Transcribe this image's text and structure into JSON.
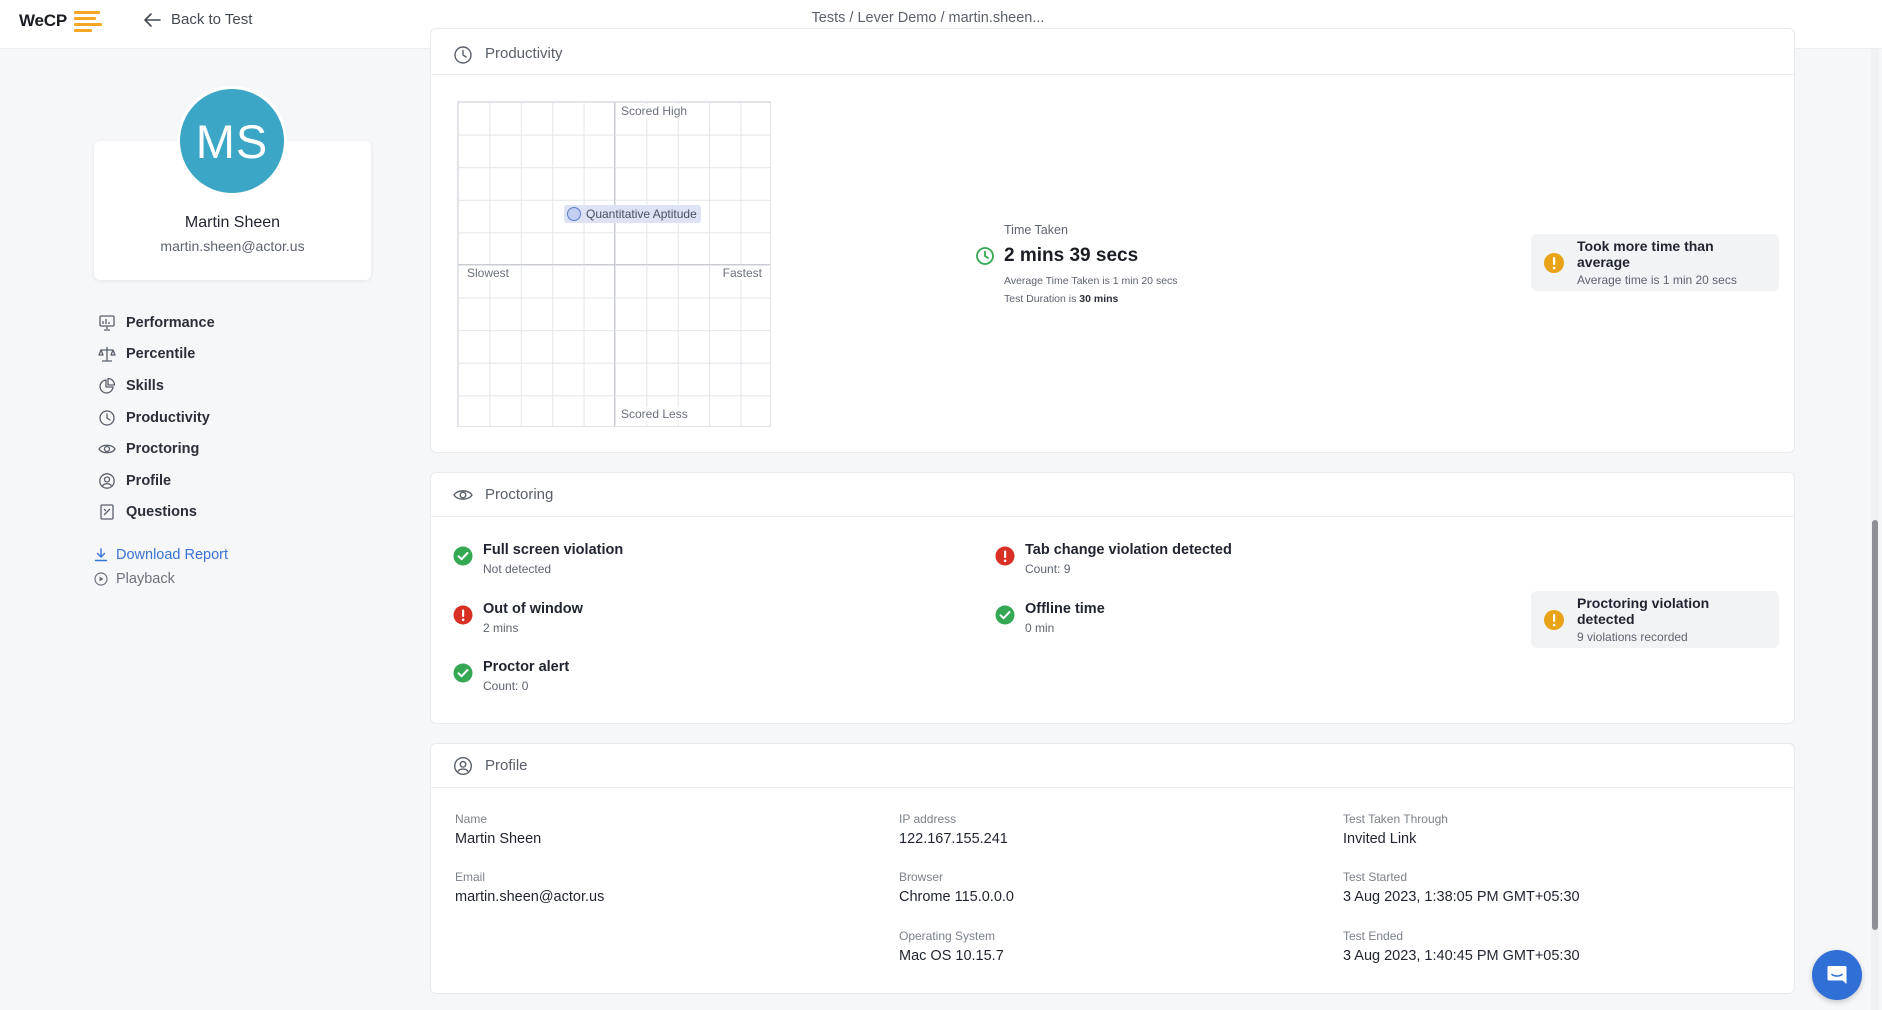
{
  "topbar": {
    "logo_text": "WeCP",
    "back_label": "Back to Test",
    "breadcrumb": "Tests / Lever Demo / martin.sheen..."
  },
  "candidate": {
    "initials": "MS",
    "name": "Martin Sheen",
    "email": "martin.sheen@actor.us",
    "avatar_color": "#3ba6c6"
  },
  "nav": {
    "items": [
      {
        "label": "Performance",
        "icon": "performance-icon"
      },
      {
        "label": "Percentile",
        "icon": "scale-icon"
      },
      {
        "label": "Skills",
        "icon": "pie-chart-icon"
      },
      {
        "label": "Productivity",
        "icon": "clock-icon"
      },
      {
        "label": "Proctoring",
        "icon": "eye-icon"
      },
      {
        "label": "Profile",
        "icon": "user-circle-icon"
      },
      {
        "label": "Questions",
        "icon": "questions-icon"
      }
    ],
    "download_label": "Download Report",
    "playback_label": "Playback"
  },
  "productivity": {
    "title": "Productivity",
    "chart_data": {
      "type": "scatter",
      "quadrant_labels": {
        "top": "Scored High",
        "bottom": "Scored Less",
        "left": "Slowest",
        "right": "Fastest"
      },
      "points": [
        {
          "label": "Quantitative Aptitude",
          "quadrant": "top-left"
        }
      ]
    },
    "time_taken_label": "Time Taken",
    "time_taken_value": "2 mins 39 secs",
    "avg_time_text": "Average Time Taken is 1 min 20 secs",
    "duration_prefix": "Test Duration is",
    "duration_value": "30 mins",
    "alert": {
      "title": "Took more time than average",
      "subtitle": "Average time is 1 min 20 secs"
    }
  },
  "proctoring": {
    "title": "Proctoring",
    "items": [
      {
        "title": "Full screen violation",
        "subtitle": "Not detected",
        "status": "ok"
      },
      {
        "title": "Tab change violation detected",
        "subtitle": "Count: 9",
        "status": "error"
      },
      {
        "title": "Out of window",
        "subtitle": "2 mins",
        "status": "error"
      },
      {
        "title": "Offline time",
        "subtitle": "0 min",
        "status": "ok"
      },
      {
        "title": "Proctor alert",
        "subtitle": "Count: 0",
        "status": "ok"
      }
    ],
    "alert": {
      "title": "Proctoring violation detected",
      "subtitle": "9 violations recorded"
    }
  },
  "profile": {
    "title": "Profile",
    "fields": {
      "name": {
        "label": "Name",
        "value": "Martin Sheen"
      },
      "email": {
        "label": "Email",
        "value": "martin.sheen@actor.us"
      },
      "ip": {
        "label": "IP address",
        "value": "122.167.155.241"
      },
      "browser": {
        "label": "Browser",
        "value": "Chrome 115.0.0.0"
      },
      "os": {
        "label": "Operating System",
        "value": "Mac OS 10.15.7"
      },
      "through": {
        "label": "Test Taken Through",
        "value": "Invited Link"
      },
      "started": {
        "label": "Test Started",
        "value": "3 Aug 2023, 1:38:05 PM GMT+05:30"
      },
      "ended": {
        "label": "Test Ended",
        "value": "3 Aug 2023, 1:40:45 PM GMT+05:30"
      }
    }
  },
  "colors": {
    "accent": "#3a73d6",
    "success": "#34a853",
    "error": "#d93025",
    "warning": "#e8a317"
  }
}
